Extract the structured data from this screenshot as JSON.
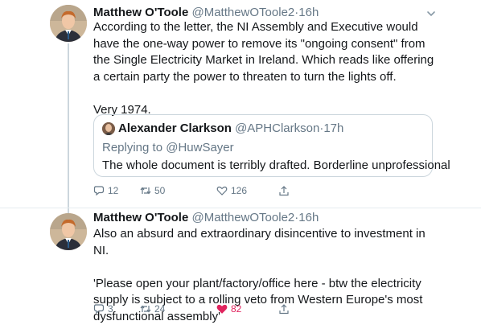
{
  "tweets": [
    {
      "name": "Matthew O'Toole",
      "handle": "@MatthewOToole2",
      "time": "16h",
      "text": "According to the letter, the NI Assembly and Executive would have the one-way power to remove its \"ongoing consent\" from the Single Electricity Market in Ireland. Which reads like offering a certain party the power to threaten to turn the lights off.\n\nVery 1974.",
      "quote": {
        "name": "Alexander Clarkson",
        "handle": "@APHClarkson",
        "time": "17h",
        "replying_label": "Replying to",
        "replying_handle": "@HuwSayer",
        "text": "The whole document is terribly drafted. Borderline unprofessional"
      },
      "replies": "12",
      "retweets": "50",
      "likes": "126",
      "liked": false
    },
    {
      "name": "Matthew O'Toole",
      "handle": "@MatthewOToole2",
      "time": "16h",
      "text": "Also an absurd and extraordinary disincentive to investment in NI.\n\n'Please open your plant/factory/office here - btw the electricity supply is subject to a rolling veto from Western Europe's most dysfunctional assembly'",
      "replies": "3",
      "retweets": "24",
      "likes": "82",
      "liked": true
    }
  ],
  "separator": "·",
  "colors": {
    "like_active": "#e0245e",
    "muted": "#657786",
    "border": "#ccd6dd"
  },
  "icons": [
    "reply-icon",
    "retweet-icon",
    "like-icon",
    "share-icon",
    "chevron-down-icon"
  ]
}
